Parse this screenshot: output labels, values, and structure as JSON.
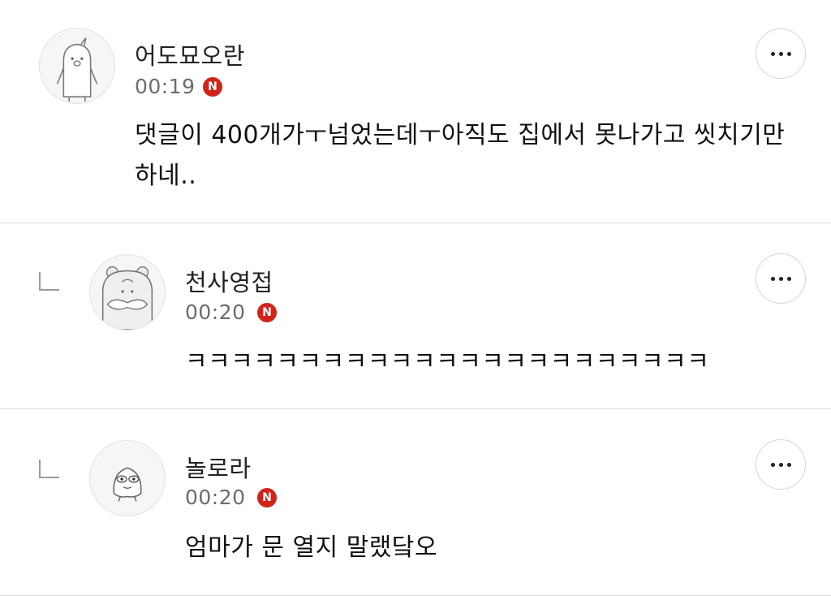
{
  "comments": [
    {
      "author": "어도묘오란",
      "time": "00:19",
      "badge": "N",
      "text": "댓글이 400개가ㅜ넘었는데ㅜ아직도 집에서 못나가고 씻치기만하네..",
      "avatar_icon": "penguin-avatar-icon",
      "is_reply": false
    },
    {
      "author": "천사영접",
      "time": "00:20",
      "badge": "N",
      "text": "ㅋㅋㅋㅋㅋㅋㅋㅋㅋㅋㅋㅋㅋㅋㅋㅋㅋㅋㅋㅋㅋㅋㅋ",
      "avatar_icon": "hamster-avatar-icon",
      "is_reply": true
    },
    {
      "author": "놀로라",
      "time": "00:20",
      "badge": "N",
      "text": "엄마가 문 열지 말랬닼오",
      "avatar_icon": "ghost-avatar-icon",
      "is_reply": true
    }
  ],
  "colors": {
    "badge": "#d0241b",
    "divider": "#dcdcdc",
    "meta_text": "#6c6c70"
  }
}
